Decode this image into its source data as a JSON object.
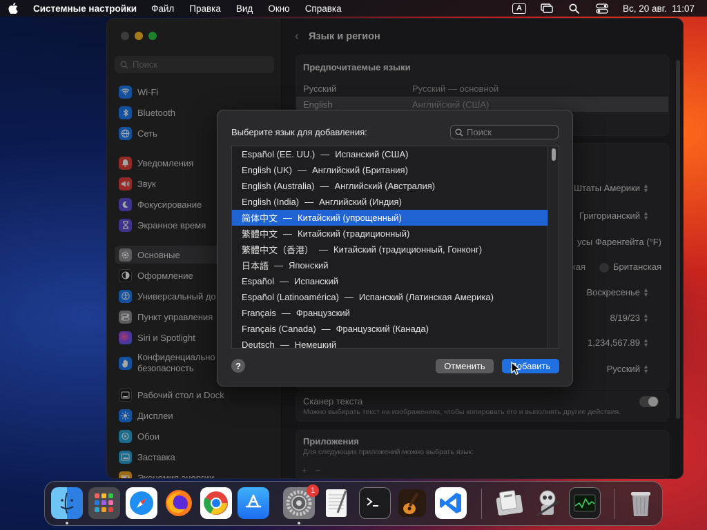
{
  "menubar": {
    "app_name": "Системные настройки",
    "menus": [
      "Файл",
      "Правка",
      "Вид",
      "Окно",
      "Справка"
    ],
    "input_source": "A",
    "clock": "Вс, 20 авг.  11:07"
  },
  "sidebar": {
    "search_placeholder": "Поиск",
    "items": [
      {
        "label": "Wi-Fi",
        "icon": "wifi-icon",
        "color": "#1e7cf2"
      },
      {
        "label": "Bluetooth",
        "icon": "bluetooth-icon",
        "color": "#1e7cf2"
      },
      {
        "label": "Сеть",
        "icon": "globe-icon",
        "color": "#1e7cf2"
      },
      {
        "label": "Уведомления",
        "icon": "bell-icon",
        "color": "#e5403a"
      },
      {
        "label": "Звук",
        "icon": "speaker-icon",
        "color": "#e5403a"
      },
      {
        "label": "Фокусирование",
        "icon": "moon-icon",
        "color": "#5d4fd9"
      },
      {
        "label": "Экранное время",
        "icon": "hourglass-icon",
        "color": "#5d4fd9"
      },
      {
        "label": "Основные",
        "icon": "gear-icon",
        "color": "#8e8e93"
      },
      {
        "label": "Оформление",
        "icon": "appearance-icon",
        "color": "#1c1c1e"
      },
      {
        "label": "Универсальный до",
        "icon": "accessibility-icon",
        "color": "#1e7cf2"
      },
      {
        "label": "Пункт управления",
        "icon": "control-center-icon",
        "color": "#8e8e93"
      },
      {
        "label": "Siri и Spotlight",
        "icon": "siri-icon",
        "color": "#9b3fd6"
      },
      {
        "label": "Конфиденциально безопасность",
        "label_line1": "Конфиденциально",
        "label_line2": "безопасность",
        "icon": "hand-icon",
        "color": "#1e7cf2"
      },
      {
        "label": "Рабочий стол и Dock",
        "icon": "desktop-icon",
        "color": "#1c1c1e"
      },
      {
        "label": "Дисплеи",
        "icon": "sun-icon",
        "color": "#1e7cf2"
      },
      {
        "label": "Обои",
        "icon": "wallpaper-icon",
        "color": "#2aa6d8"
      },
      {
        "label": "Заставка",
        "icon": "screensaver-icon",
        "color": "#2aa6d8"
      },
      {
        "label": "Экономия энергии",
        "icon": "battery-icon",
        "color": "#f2a11e"
      }
    ]
  },
  "content": {
    "title": "Язык и регион",
    "preferred_title": "Предпочитаемые языки",
    "languages": [
      {
        "name": "Русский",
        "desc": "Русский — основной"
      },
      {
        "name": "English",
        "desc": "Английский (США)"
      }
    ],
    "settings_values": [
      "Штаты Америки",
      "Григорианский",
      "усы Фаренгейта (°F)",
      "кая",
      "Британская",
      "Воскресенье",
      "8/19/23",
      "1,234,567.89",
      "Русский"
    ],
    "live_text_title": "Сканер текста",
    "live_text_desc": "Можно выбирать текст на изображениях, чтобы копировать его и выполнять другие действия.",
    "apps_title": "Приложения",
    "apps_desc": "Для следующих приложений можно выбрать язык:",
    "add": "+",
    "remove": "−"
  },
  "dialog": {
    "prompt": "Выберите язык для добавления:",
    "search_placeholder": "Поиск",
    "items": [
      {
        "name": "Español (EE. UU.)",
        "desc": "Испанский (США)"
      },
      {
        "name": "English (UK)",
        "desc": "Английский (Британия)"
      },
      {
        "name": "English (Australia)",
        "desc": "Английский (Австралия)"
      },
      {
        "name": "English (India)",
        "desc": "Английский (Индия)"
      },
      {
        "name": "简体中文",
        "desc": "Китайский (упрощенный)"
      },
      {
        "name": "繁體中文",
        "desc": "Китайский (традиционный)"
      },
      {
        "name": "繁體中文（香港）",
        "desc": "Китайский (традиционный, Гонконг)"
      },
      {
        "name": "日本語",
        "desc": "Японский"
      },
      {
        "name": "Español",
        "desc": "Испанский"
      },
      {
        "name": "Español (Latinoamérica)",
        "desc": "Испанский (Латинская Америка)"
      },
      {
        "name": "Français",
        "desc": "Французский"
      },
      {
        "name": "Français (Canada)",
        "desc": "Французский (Канада)"
      },
      {
        "name": "Deutsch",
        "desc": "Немецкий"
      }
    ],
    "selected_index": 4,
    "help": "?",
    "cancel": "Отменить",
    "add": "Добавить"
  },
  "dock": {
    "apps": [
      {
        "icon": "finder-icon",
        "running": true
      },
      {
        "icon": "launchpad-icon",
        "running": false
      },
      {
        "icon": "safari-icon",
        "running": false
      },
      {
        "icon": "firefox-icon",
        "running": false
      },
      {
        "icon": "chrome-icon",
        "running": false
      },
      {
        "icon": "app-store-icon",
        "running": false
      },
      {
        "icon": "system-settings-icon",
        "running": true,
        "badge": "1"
      },
      {
        "icon": "textedit-icon",
        "running": false
      },
      {
        "icon": "terminal-icon",
        "running": false
      },
      {
        "icon": "garageband-icon",
        "running": false
      },
      {
        "icon": "vscode-icon",
        "running": false
      },
      {
        "icon": "system-information-icon",
        "running": false
      },
      {
        "icon": "automator-icon",
        "running": false
      },
      {
        "icon": "activity-monitor-icon",
        "running": false
      },
      {
        "icon": "trash-icon",
        "running": false
      }
    ]
  }
}
